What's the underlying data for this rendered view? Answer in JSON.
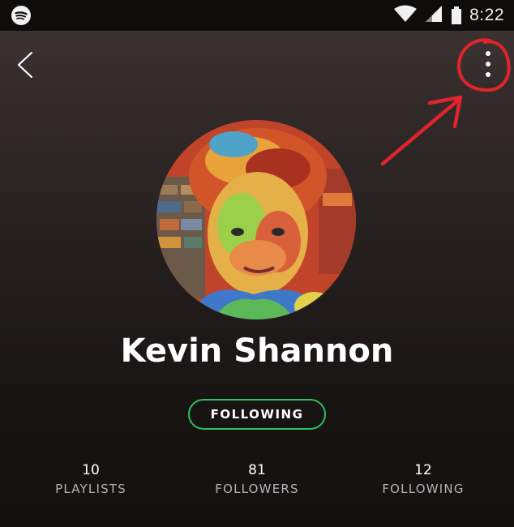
{
  "status_bar": {
    "time": "8:22",
    "icons": [
      "spotify-notification-icon",
      "wifi-icon",
      "cell-signal-icon",
      "battery-icon"
    ]
  },
  "nav": {
    "back_icon": "chevron-left-icon",
    "more_icon": "more-vertical-icon"
  },
  "profile": {
    "name": "Kevin Shannon",
    "follow_button_label": "FOLLOWING"
  },
  "stats": [
    {
      "value": "10",
      "label": "PLAYLISTS"
    },
    {
      "value": "81",
      "label": "FOLLOWERS"
    },
    {
      "value": "12",
      "label": "FOLLOWING"
    }
  ],
  "colors": {
    "accent_green": "#2cc15a",
    "annotation_red": "#e0242b",
    "background_top": "#3f3534",
    "background_bottom": "#141111"
  }
}
